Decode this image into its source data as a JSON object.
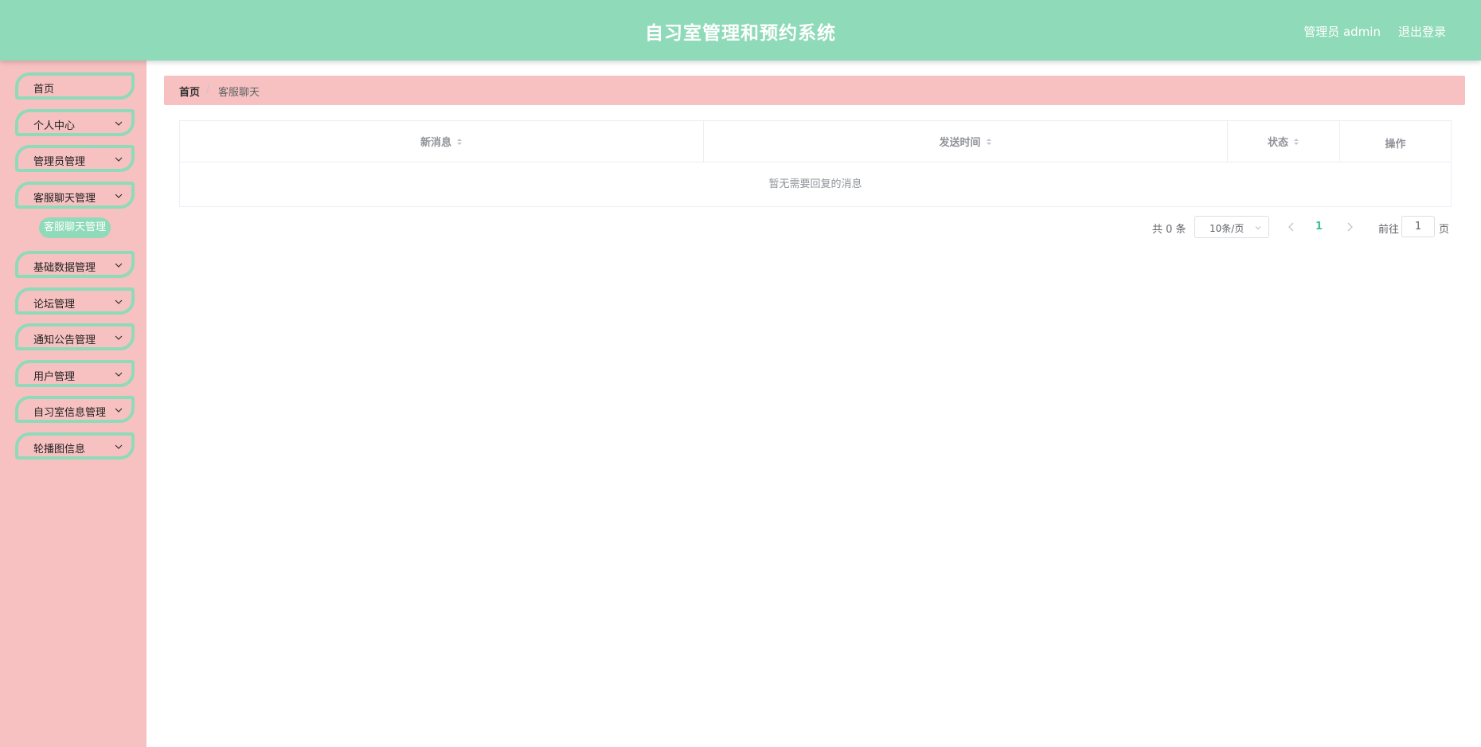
{
  "header": {
    "title": "自习室管理和预约系统",
    "user": "管理员 admin",
    "logout": "退出登录",
    "bg_color": "#8fdab8"
  },
  "sidebar": {
    "bg_color": "#f7c1c1",
    "items": [
      {
        "label": "首页",
        "has_chevron": false
      },
      {
        "label": "个人中心",
        "has_chevron": true
      },
      {
        "label": "管理员管理",
        "has_chevron": true
      },
      {
        "label": "客服聊天管理",
        "has_chevron": true
      },
      {
        "label": "基础数据管理",
        "has_chevron": true
      },
      {
        "label": "论坛管理",
        "has_chevron": true
      },
      {
        "label": "通知公告管理",
        "has_chevron": true
      },
      {
        "label": "用户管理",
        "has_chevron": true
      },
      {
        "label": "自习室信息管理",
        "has_chevron": true
      },
      {
        "label": "轮播图信息",
        "has_chevron": true
      }
    ],
    "submenu": {
      "label": "客服聊天管理"
    }
  },
  "breadcrumb": {
    "home": "首页",
    "separator": "/",
    "current": "客服聊天"
  },
  "table": {
    "columns": [
      {
        "label": "新消息",
        "sortable": true
      },
      {
        "label": "发送时间",
        "sortable": true
      },
      {
        "label": "状态",
        "sortable": true
      },
      {
        "label": "操作",
        "sortable": false
      }
    ],
    "empty_text": "暂无需要回复的消息"
  },
  "pagination": {
    "total": "共 0 条",
    "page_size": "10条/页",
    "current_page": "1",
    "goto_label": "前往",
    "goto_value": "1",
    "goto_unit": "页",
    "accent_color": "#3cc28f"
  }
}
